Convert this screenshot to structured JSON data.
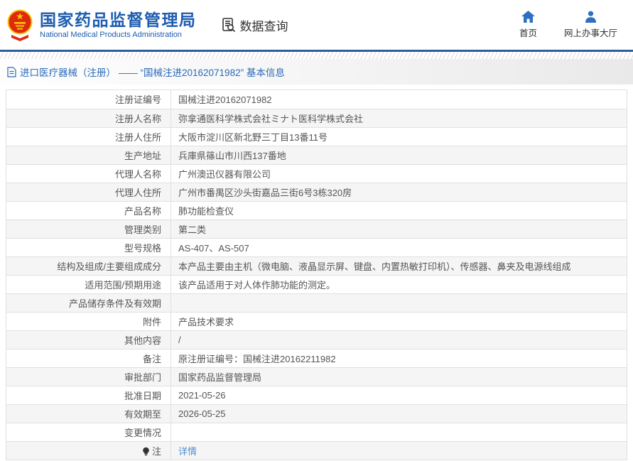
{
  "header": {
    "agency_cn": "国家药品监督管理局",
    "agency_en": "National Medical Products Administration",
    "section_label": "数据查询",
    "nav": [
      {
        "label": "首页",
        "icon": "home-icon"
      },
      {
        "label": "网上办事大厅",
        "icon": "user-icon"
      }
    ]
  },
  "breadcrumb": {
    "text": "进口医疗器械（注册） —— “国械注进20162071982” 基本信息"
  },
  "colors": {
    "brand_blue": "#1d5cb0",
    "icon_blue": "#2e6fc0",
    "link_blue": "#4e8fd3",
    "stripe_gray": "#f5f5f5",
    "border_gray": "#e0e0e0",
    "divider_blue": "#2b5f9e"
  },
  "table": {
    "rows": [
      {
        "label": "注册证编号",
        "value": "国械注进20162071982"
      },
      {
        "label": "注册人名称",
        "value": "弥拿通医科学株式会社ミナト医科学株式会社"
      },
      {
        "label": "注册人住所",
        "value": "大阪市淀川区新北野三丁目13番11号"
      },
      {
        "label": "生产地址",
        "value": "兵庫県篠山市川西137番地"
      },
      {
        "label": "代理人名称",
        "value": "广州澳迅仪器有限公司"
      },
      {
        "label": "代理人住所",
        "value": "广州市番禺区沙头街嘉品三街6号3栋320房"
      },
      {
        "label": "产品名称",
        "value": "肺功能检查仪"
      },
      {
        "label": "管理类别",
        "value": "第二类"
      },
      {
        "label": "型号规格",
        "value": "AS-407、AS-507"
      },
      {
        "label": "结构及组成/主要组成成分",
        "value": "本产品主要由主机（微电脑、液晶显示屏、键盘、内置热敏打印机）、传感器、鼻夹及电源线组成"
      },
      {
        "label": "适用范围/预期用途",
        "value": "该产品适用于对人体作肺功能的测定。"
      },
      {
        "label": "产品储存条件及有效期",
        "value": ""
      },
      {
        "label": "附件",
        "value": "产品技术要求"
      },
      {
        "label": "其他内容",
        "value": "/"
      },
      {
        "label": "备注",
        "value": "原注册证编号：国械注进20162211982"
      },
      {
        "label": "审批部门",
        "value": "国家药品监督管理局"
      },
      {
        "label": "批准日期",
        "value": "2021-05-26"
      },
      {
        "label": "有效期至",
        "value": "2026-05-25"
      },
      {
        "label": "变更情况",
        "value": ""
      },
      {
        "label": "注",
        "label_icon": "bulb-icon",
        "value": "详情",
        "value_is_link": true
      }
    ]
  }
}
